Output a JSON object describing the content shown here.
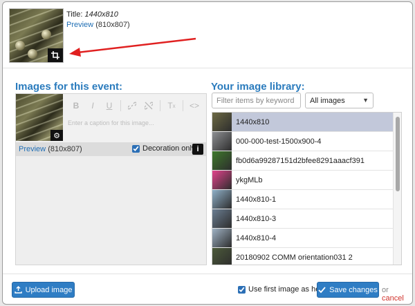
{
  "header": {
    "title_label": "Title:",
    "title_value": "1440x810",
    "preview_link": "Preview",
    "preview_size": "(810x807)",
    "crop_icon": "crop-icon"
  },
  "left": {
    "heading": "Images for this event:",
    "toolbar": {
      "bold": "B",
      "italic": "I",
      "underline": "U",
      "clear": "T",
      "code": "<>"
    },
    "caption_placeholder": "Enter a caption for this image...",
    "preview_link": "Preview",
    "preview_size": "(810x807)",
    "decoration_label": "Decoration only",
    "decoration_checked": true,
    "info": "i"
  },
  "right": {
    "heading": "Your image library:",
    "filter_placeholder": "Filter items by keyword",
    "select_value": "All images",
    "items": [
      {
        "label": "1440x810",
        "selected": true,
        "thumb": "#6d6a44"
      },
      {
        "label": "000-000-test-1500x900-4",
        "selected": false,
        "thumb": "#8d8f92"
      },
      {
        "label": "fb0d6a99287151d2bfee8291aaacf391",
        "selected": false,
        "thumb": "#3f7a2c"
      },
      {
        "label": "ykgMLb",
        "selected": false,
        "thumb": "#e2438c"
      },
      {
        "label": "1440x810-1",
        "selected": false,
        "thumb": "#8fb0c8"
      },
      {
        "label": "1440x810-3",
        "selected": false,
        "thumb": "#6b7e92"
      },
      {
        "label": "1440x810-4",
        "selected": false,
        "thumb": "#9fb2c4"
      },
      {
        "label": "20180902 COMM orientation031 2",
        "selected": false,
        "thumb": "#4c5a3a"
      }
    ]
  },
  "footer": {
    "upload_label": "Upload image",
    "hero_label": "Use first image as hero",
    "hero_checked": true,
    "save_label": "Save changes",
    "or_text": "or",
    "cancel_label": "cancel"
  },
  "colors": {
    "accent": "#2f7dc4",
    "heading": "#2a7bbd",
    "cancel": "#d0322b",
    "selected_row": "#c2c8da"
  }
}
